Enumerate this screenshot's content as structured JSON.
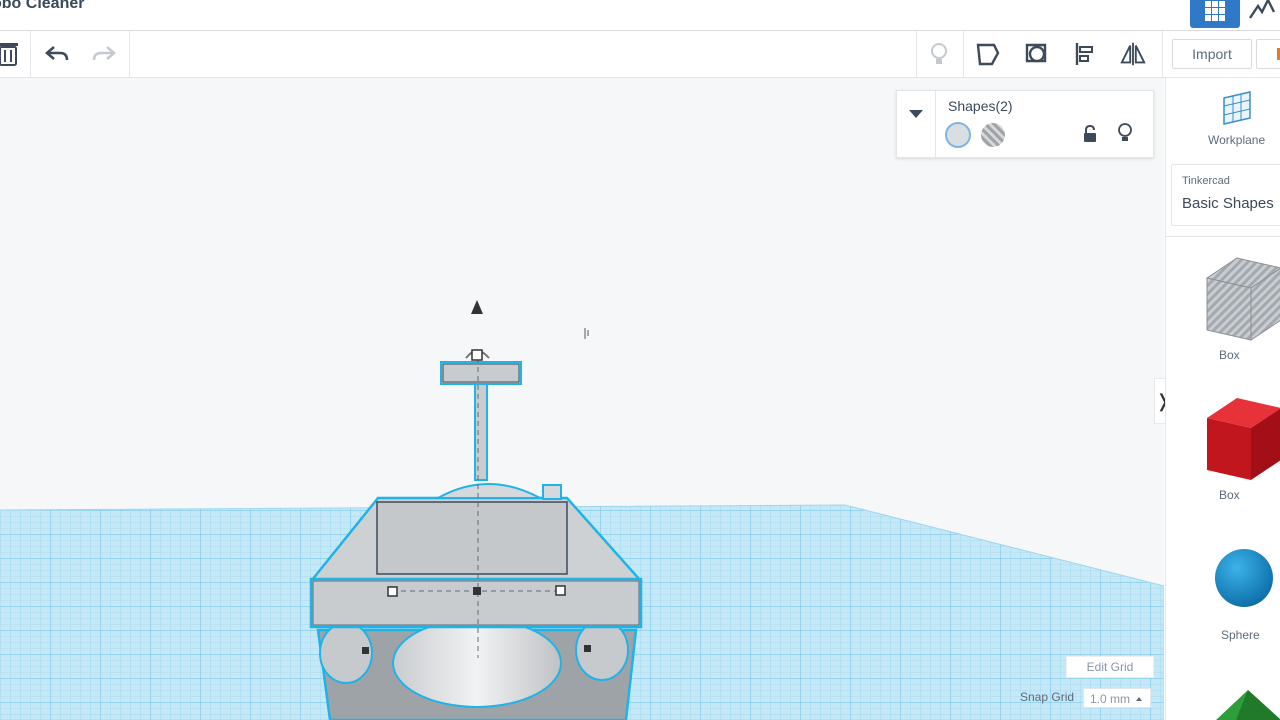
{
  "app": {
    "title": "obo Cleaner"
  },
  "toolbar": {
    "delete_icon": "trash-icon",
    "undo_icon": "undo-arrow-icon",
    "redo_icon": "redo-arrow-icon",
    "show_all_icon": "lightbulb-icon",
    "group_icon": "group-icon",
    "ungroup_icon": "ungroup-icon",
    "align_icon": "align-icon",
    "mirror_icon": "mirror-icon",
    "import_label": "Import"
  },
  "inspector": {
    "title": "Shapes(2)",
    "solid_swatch_color": "#d9dee3",
    "hole_swatch": "hole-hatch-swatch",
    "lock_icon": "unlock-icon",
    "visibility_icon": "lightbulb-icon"
  },
  "right_panel": {
    "workplane_label": "Workplane",
    "library_category": "Tinkercad",
    "library_name": "Basic Shapes",
    "shapes": [
      {
        "label": "Box",
        "color": "#a9b0b8",
        "kind": "hole-box"
      },
      {
        "label": "Box",
        "color": "#d32027",
        "kind": "box"
      },
      {
        "label": "Sphere",
        "color": "#1a8ccf",
        "kind": "sphere"
      }
    ]
  },
  "viewport": {
    "edit_grid_label": "Edit Grid",
    "snap_grid_label": "Snap Grid",
    "snap_grid_value": "1.0 mm",
    "selection_color": "#1fb3e8"
  }
}
